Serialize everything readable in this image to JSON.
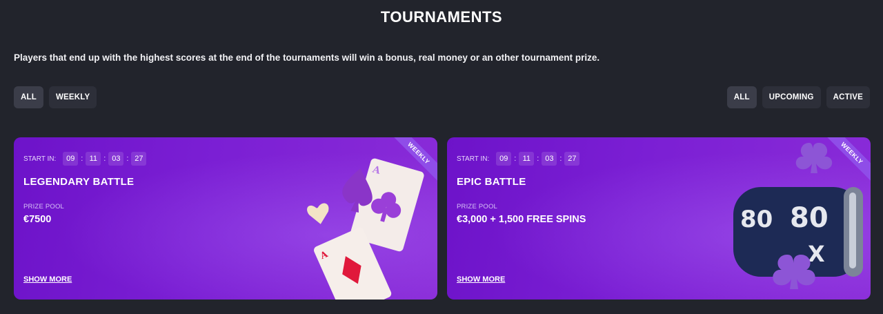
{
  "page": {
    "title": "TOURNAMENTS",
    "intro": "Players that end up with the highest scores at the end of the tournaments will win a bonus, real money or an other tournament prize."
  },
  "filters": {
    "type": [
      "ALL",
      "WEEKLY"
    ],
    "status": [
      "ALL",
      "UPCOMING",
      "ACTIVE"
    ],
    "type_selected": "ALL",
    "status_selected": "ALL"
  },
  "cards": [
    {
      "badge": "WEEKLY",
      "start_label": "START IN:",
      "timer": [
        "09",
        "11",
        "03",
        "27"
      ],
      "title": "LEGENDARY BATTLE",
      "prize_label": "PRIZE POOL",
      "prize_value": "€7500",
      "link": "SHOW MORE"
    },
    {
      "badge": "WEEKLY",
      "start_label": "START IN:",
      "timer": [
        "09",
        "11",
        "03",
        "27"
      ],
      "title": "EPIC BATTLE",
      "prize_label": "PRIZE POOL",
      "prize_value": "€3,000 + 1,500 FREE SPINS",
      "link": "SHOW MORE",
      "art_text": [
        "80",
        "80",
        "X"
      ]
    }
  ],
  "colors": {
    "background": "#22242c",
    "chip": "#2d2f39",
    "chip_active": "#3b3d49",
    "card_purple": "#7b1fd4",
    "badge": "#8f4de8"
  }
}
